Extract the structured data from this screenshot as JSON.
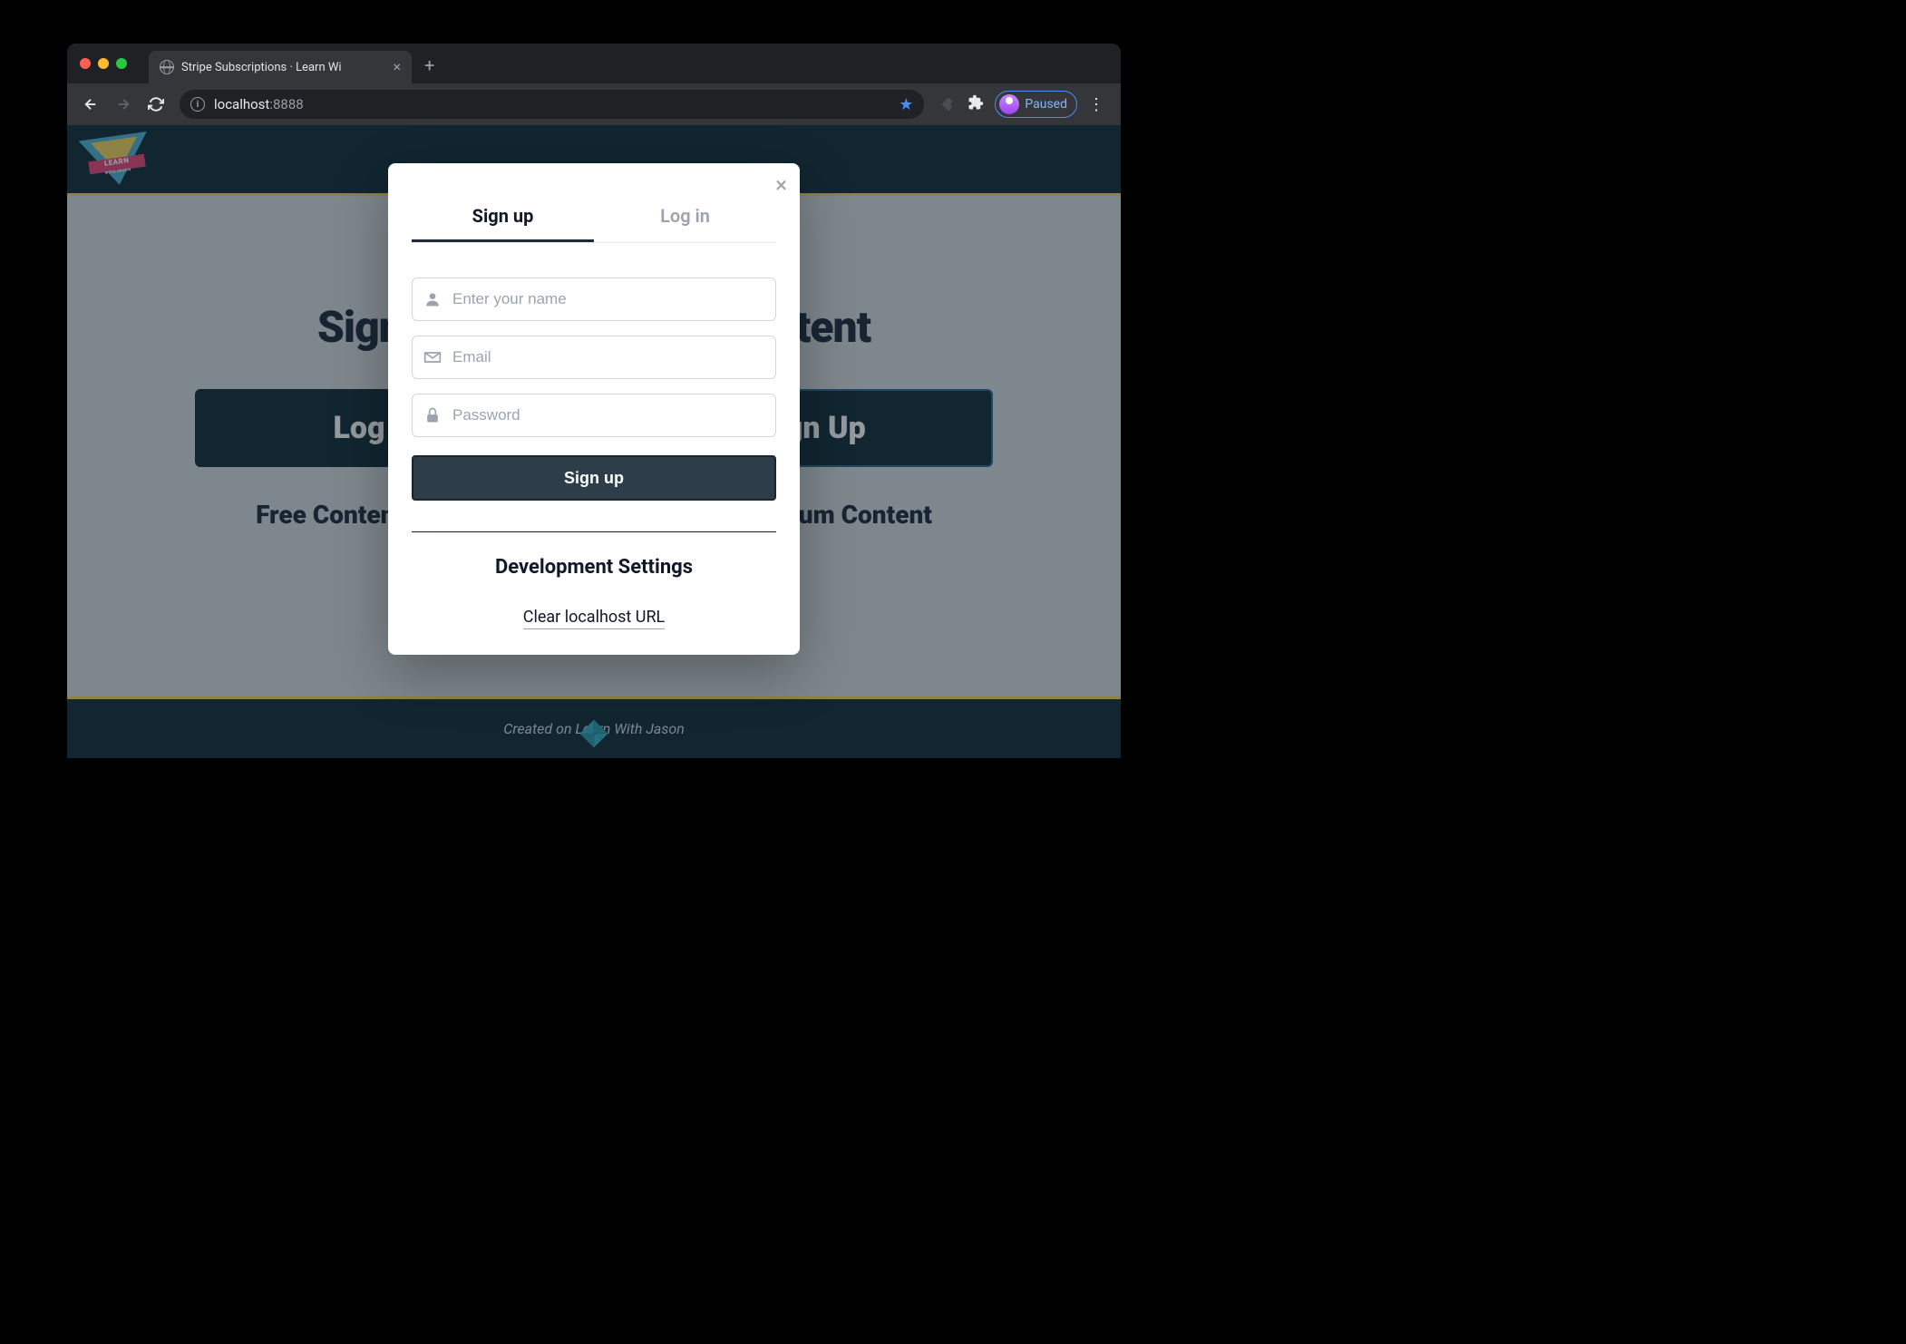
{
  "browser": {
    "tab_title": "Stripe Subscriptions · Learn Wi",
    "url_host": "localhost",
    "url_port": ":8888",
    "profile_status": "Paused"
  },
  "page": {
    "logo_text": "LEARN",
    "logo_sub": "WITH JASON",
    "hero_title": "Sign Up for Premium Content",
    "btn_left": "Log In",
    "btn_right": "Sign Up",
    "label_left": "Free Content",
    "label_right": "Premium Content",
    "footer_prefix": "Created on ",
    "footer_link": "Learn With Jason"
  },
  "modal": {
    "tab_signup": "Sign up",
    "tab_login": "Log in",
    "name_placeholder": "Enter your name",
    "email_placeholder": "Email",
    "password_placeholder": "Password",
    "submit_label": "Sign up",
    "dev_heading": "Development Settings",
    "clear_link": "Clear localhost URL"
  }
}
